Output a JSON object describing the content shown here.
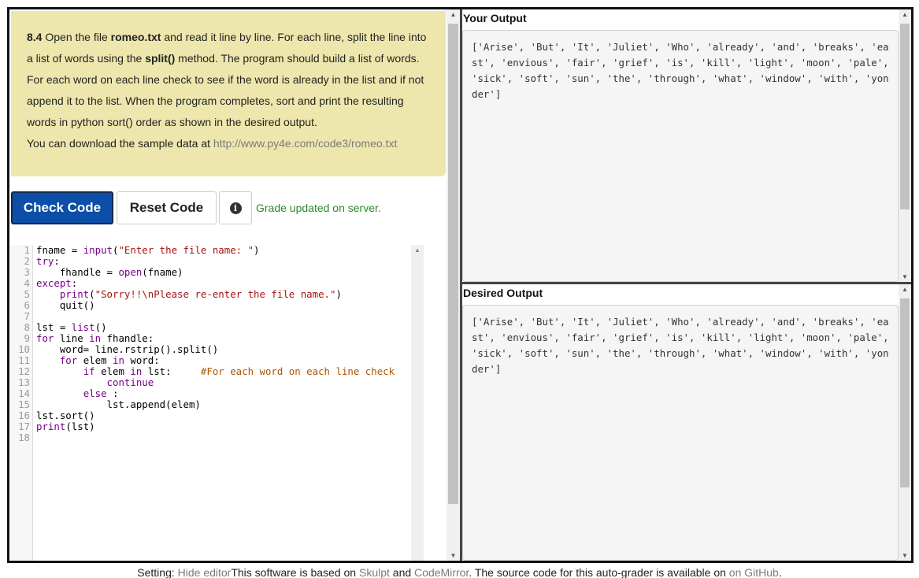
{
  "assignment": {
    "number": "8.4",
    "text_1": " Open the file ",
    "file": "romeo.txt",
    "text_2": " and read it line by line. For each line, split the line into a list of words using the ",
    "method": "split()",
    "text_3": " method. The program should build a list of words. For each word on each line check to see if the word is already in the list and if not append it to the list. When the program completes, sort and print the resulting words in python sort() order as shown in the desired output.",
    "download_text": "You can download the sample data at ",
    "download_link": "http://www.py4e.com/code3/romeo.txt"
  },
  "toolbar": {
    "check_label": "Check Code",
    "reset_label": "Reset Code",
    "info_glyph": "i",
    "status": "Grade updated on server."
  },
  "code": {
    "line_numbers": [
      "1",
      "2",
      "3",
      "4",
      "5",
      "6",
      "7",
      "8",
      "9",
      "10",
      "11",
      "12",
      "13",
      "14",
      "15",
      "16",
      "17",
      "18"
    ]
  },
  "your_output": {
    "title": "Your Output",
    "text": "['Arise', 'But', 'It', 'Juliet', 'Who', 'already', 'and', 'breaks', 'east', 'envious', 'fair', 'grief', 'is', 'kill', 'light', 'moon', 'pale', 'sick', 'soft', 'sun', 'the', 'through', 'what', 'window', 'with', 'yonder']"
  },
  "desired_output": {
    "title": "Desired Output",
    "text": "['Arise', 'But', 'It', 'Juliet', 'Who', 'already', 'and', 'breaks', 'east', 'envious', 'fair', 'grief', 'is', 'kill', 'light', 'moon', 'pale', 'sick', 'soft', 'sun', 'the', 'through', 'what', 'window', 'with', 'yonder']"
  },
  "footer": {
    "setting": "Setting: ",
    "hide_editor": "Hide editor",
    "based_on": "This software is based on ",
    "skulpt": "Skulpt",
    "and": " and ",
    "codemirror": "CodeMirror",
    "source": ". The source code for this auto-grader is available on ",
    "github": "on GitHub",
    "end": "."
  },
  "colors": {
    "instruction_bg": "#ede7ad",
    "check_button": "#0c4ea8",
    "status_green": "#2c8a2c"
  }
}
